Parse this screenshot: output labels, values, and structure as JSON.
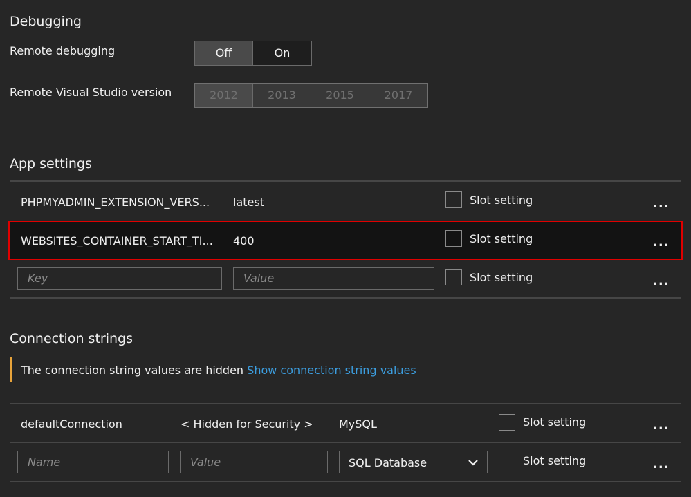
{
  "debugging": {
    "title": "Debugging",
    "remote_debugging_label": "Remote debugging",
    "remote_debugging_options": [
      "Off",
      "On"
    ],
    "remote_debugging_selected": "Off",
    "vs_version_label": "Remote Visual Studio version",
    "vs_versions": [
      "2012",
      "2013",
      "2015",
      "2017"
    ],
    "vs_version_selected": "2012"
  },
  "app_settings": {
    "title": "App settings",
    "rows": [
      {
        "key": "PHPMYADMIN_EXTENSION_VERS...",
        "value": "latest",
        "slot_label": "Slot setting"
      },
      {
        "key": "WEBSITES_CONTAINER_START_TI...",
        "value": "400",
        "slot_label": "Slot setting"
      }
    ],
    "new_row": {
      "key_placeholder": "Key",
      "value_placeholder": "Value",
      "slot_label": "Slot setting"
    },
    "more": "...",
    "highlight_color": "#e00000"
  },
  "connection_strings": {
    "title": "Connection strings",
    "notice": "The connection string values are hidden",
    "notice_link": "Show connection string values",
    "rows": [
      {
        "name": "defaultConnection",
        "value": "< Hidden for Security >",
        "type": "MySQL",
        "slot_label": "Slot setting"
      }
    ],
    "new_row": {
      "name_placeholder": "Name",
      "value_placeholder": "Value",
      "type": "SQL Database",
      "slot_label": "Slot setting"
    },
    "more": "..."
  }
}
